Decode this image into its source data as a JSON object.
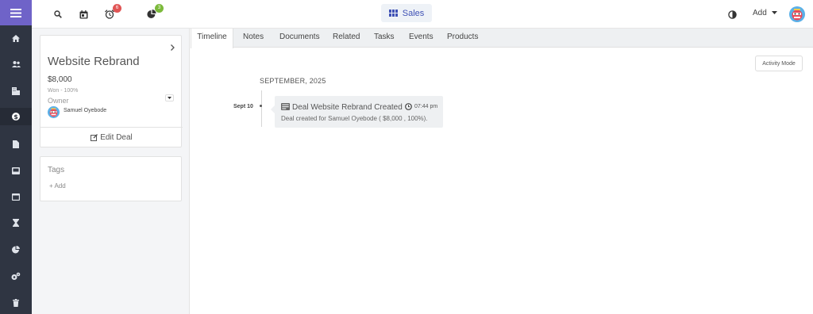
{
  "header": {
    "app_button_label": "Sales",
    "add_label": "Add",
    "notifications": {
      "reminders_count": "6",
      "activity_count": "3"
    }
  },
  "deal": {
    "title": "Website Rebrand",
    "amount": "$8,000",
    "status": "Won - 100%",
    "owner_label": "Owner",
    "owner_name": "Samuel Oyebode",
    "edit_label": "Edit Deal"
  },
  "tags": {
    "label": "Tags",
    "add_label": "Add"
  },
  "tabs": [
    {
      "label": "Timeline",
      "active": true
    },
    {
      "label": "Notes"
    },
    {
      "label": "Documents"
    },
    {
      "label": "Related"
    },
    {
      "label": "Tasks"
    },
    {
      "label": "Events"
    },
    {
      "label": "Products"
    }
  ],
  "timeline": {
    "activity_mode_label": "Activity Mode",
    "month": "SEPTEMBER, 2025",
    "events": [
      {
        "date": "Sept 10",
        "title": "Deal Website Rebrand Created",
        "time": "07:44 pm",
        "description": "Deal created for Samuel Oyebode ( $8,000 , 100%)."
      }
    ]
  },
  "sidebar": {
    "items": [
      "home-icon",
      "contacts-icon",
      "companies-icon",
      "deals-icon",
      "documents-icon",
      "inbox-icon",
      "calendar-icon",
      "hourglass-icon",
      "reports-icon",
      "settings-icon",
      "trash-icon"
    ]
  },
  "colors": {
    "sidebar_bg": "#2f3542",
    "burger_bg": "#6f63c8",
    "accent": "#3f51b5",
    "badge_red": "#e05454",
    "badge_green": "#7cba3b"
  }
}
